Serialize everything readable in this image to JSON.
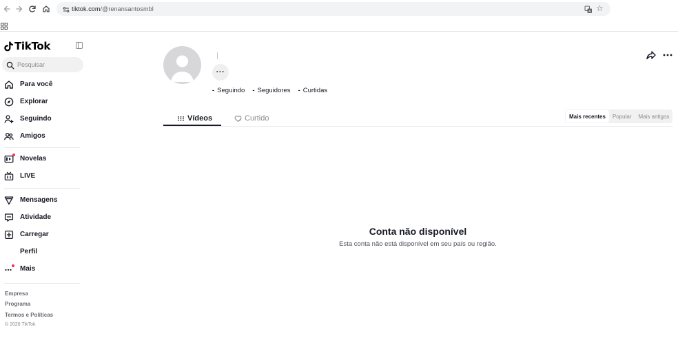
{
  "browser": {
    "url_host": "tiktok.com",
    "url_path": "/@renansantosmbl",
    "icons": [
      "back-arrow",
      "forward-arrow",
      "reload",
      "home",
      "site-info",
      "translate",
      "star",
      "apps-grid"
    ]
  },
  "sidebar": {
    "logo_text": "TikTok",
    "search_placeholder": "Pesquisar",
    "nav_group_1": [
      {
        "label": "Para você",
        "icon": "home-icon"
      },
      {
        "label": "Explorar",
        "icon": "compass-icon"
      },
      {
        "label": "Seguindo",
        "icon": "user-plus-icon"
      },
      {
        "label": "Amigos",
        "icon": "friends-icon"
      }
    ],
    "nav_group_2": [
      {
        "label": "Novelas",
        "icon": "film-icon"
      },
      {
        "label": "LIVE",
        "icon": "live-tv-icon"
      }
    ],
    "nav_group_3": [
      {
        "label": "Mensagens",
        "icon": "send-icon"
      },
      {
        "label": "Atividade",
        "icon": "chat-icon"
      },
      {
        "label": "Carregar",
        "icon": "upload-plus-icon"
      },
      {
        "label": "Perfil",
        "icon": ""
      },
      {
        "label": "Mais",
        "icon": "more-dots-icon"
      }
    ],
    "footer": {
      "links": [
        "Empresa",
        "Programa",
        "Termos e Políticas"
      ],
      "copyright": "© 2026 TikTok"
    }
  },
  "profile": {
    "following_value": "-",
    "following_label": "Seguindo",
    "followers_value": "-",
    "followers_label": "Seguidores",
    "likes_value": "-",
    "likes_label": "Curtidas",
    "more_button": "···"
  },
  "tabs": {
    "videos": "Vídeos",
    "liked": "Curtido"
  },
  "sort": {
    "options": [
      "Mais recentes",
      "Popular",
      "Mais antigos"
    ],
    "selected": "Mais recentes"
  },
  "empty_state": {
    "title": "Conta não disponível",
    "message": "Esta conta não está disponível em seu país ou região."
  },
  "colors": {
    "text_primary": "#161823",
    "muted": "#8a8b91",
    "badge_red": "#fe2c55",
    "avatar_bg": "#d7d7d9"
  }
}
